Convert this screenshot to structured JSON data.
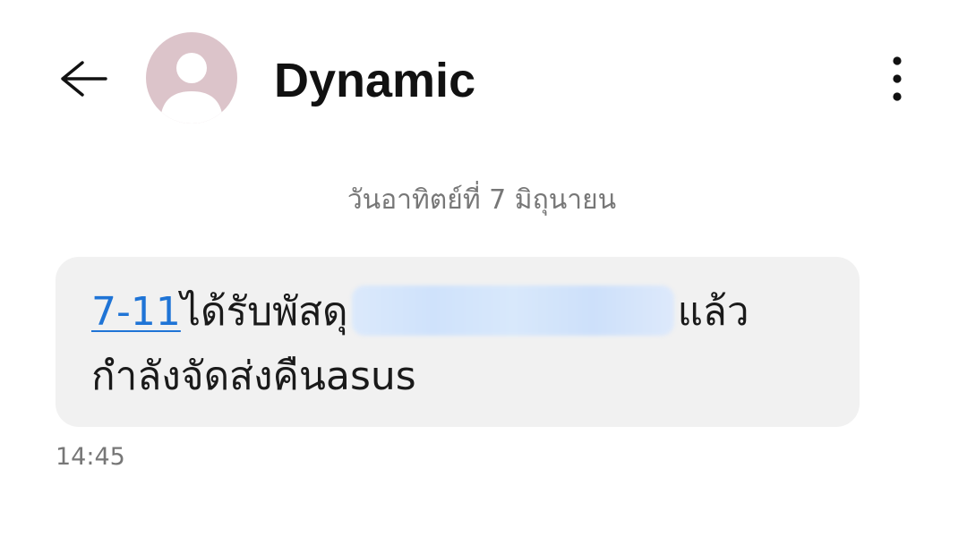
{
  "header": {
    "back_icon": "arrow-left-icon",
    "avatar_icon": "person-icon",
    "avatar_color": "#dcc4ca",
    "title": "Dynamic",
    "more_icon": "more-vertical-icon"
  },
  "conversation": {
    "date_separator": "วันอาทิตย์ที่ 7 มิถุนายน",
    "messages": [
      {
        "link_text": "7-11",
        "text_after_link": "ได้รับพัสดุ",
        "text_after_redaction": "แล้ว",
        "second_line": "กำลังจัดส่งคืนasus",
        "time": "14:45"
      }
    ]
  },
  "colors": {
    "link": "#1f74d6",
    "bubble": "#f1f1f1",
    "muted_text": "#777777"
  }
}
